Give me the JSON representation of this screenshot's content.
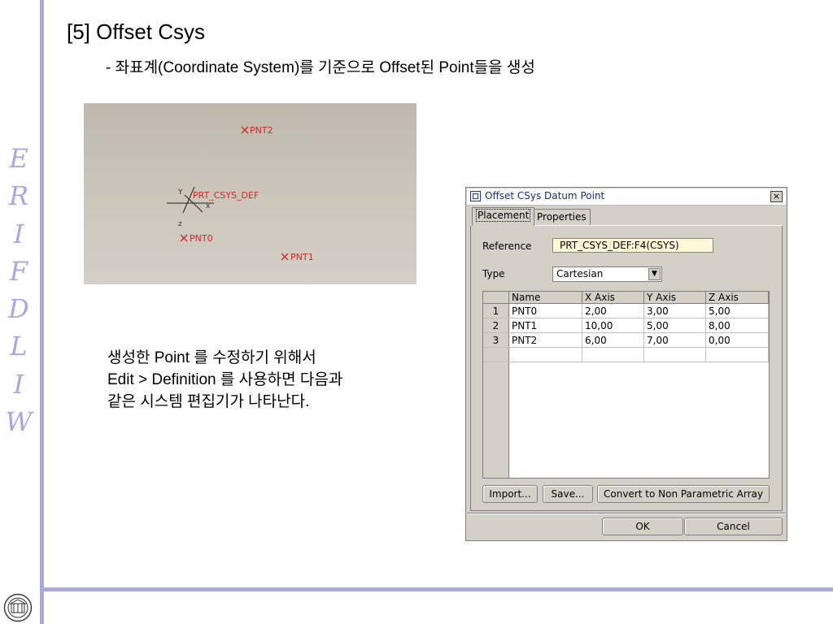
{
  "side_logo": {
    "letters": [
      "E",
      "R",
      "I",
      "F",
      "D",
      "L",
      "I",
      "W"
    ]
  },
  "slide": {
    "title": "[5] Offset Csys",
    "subtitle": "- 좌표계(Coordinate System)를 기준으로 Offset된  Point들을 생성",
    "body_lines": [
      " 생성한 Point 를 수정하기 위해서",
      "Edit > Definition 를 사용하면 다음과",
      "같은 시스템 편집기가 나타난다."
    ]
  },
  "viewport": {
    "csys_label": "PRT_CSYS_DEF",
    "axis_y": "Y",
    "axis_x": "x",
    "axis_z": "z",
    "points": [
      "PNT2",
      "PNT0",
      "PNT1"
    ],
    "colors": {
      "point_marker": "#cc2a2a",
      "background": "#c6c0b4"
    }
  },
  "dialog": {
    "title": "Offset CSys Datum Point",
    "close": "×",
    "tabs": [
      {
        "label": "Placement"
      },
      {
        "label": "Properties"
      }
    ],
    "reference_label": "Reference",
    "reference_value": "PRT_CSYS_DEF:F4(CSYS)",
    "type_label": "Type",
    "type_value": "Cartesian",
    "table": {
      "headers": [
        "",
        "Name",
        "X Axis",
        "Y Axis",
        "Z Axis"
      ],
      "rows": [
        [
          "1",
          "PNT0",
          "2,00",
          "3,00",
          "5,00"
        ],
        [
          "2",
          "PNT1",
          "10,00",
          "5,00",
          "8,00"
        ],
        [
          "3",
          "PNT2",
          "6,00",
          "7,00",
          "0,00"
        ]
      ]
    },
    "buttons": {
      "import": "Import...",
      "save": "Save...",
      "convert": "Convert to Non Parametric Array",
      "ok": "OK",
      "cancel": "Cancel"
    }
  }
}
